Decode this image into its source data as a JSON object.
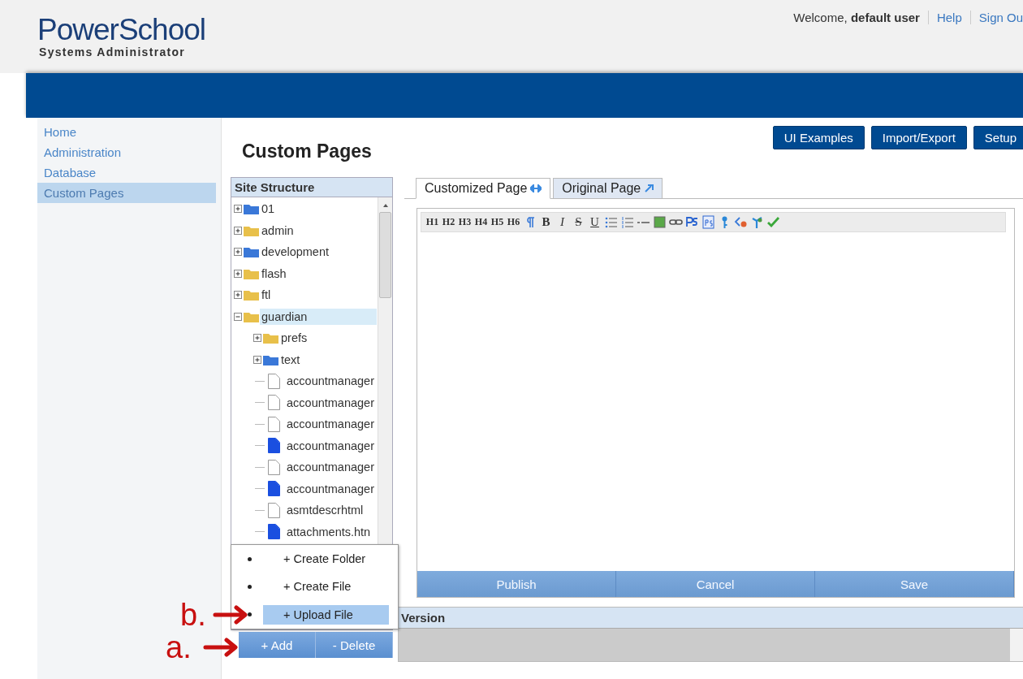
{
  "brand": {
    "name": "PowerSchool",
    "subtitle": "Systems Administrator"
  },
  "user_bar": {
    "welcome": "Welcome,",
    "user": "default user",
    "links": [
      "Help",
      "Sign Ou"
    ]
  },
  "sidebar": {
    "items": [
      {
        "label": "Home",
        "selected": false
      },
      {
        "label": "Administration",
        "selected": false
      },
      {
        "label": "Database",
        "selected": false
      },
      {
        "label": "Custom Pages",
        "selected": true
      }
    ]
  },
  "page_title": "Custom Pages",
  "header_buttons": [
    "UI Examples",
    "Import/Export",
    "Setup"
  ],
  "site_structure": {
    "title": "Site Structure",
    "tree": [
      {
        "name": "01",
        "kind": "folder",
        "color": "#3a78d8",
        "expanded": false,
        "selected": false
      },
      {
        "name": "admin",
        "kind": "folder",
        "color": "#e8c04a",
        "expanded": false,
        "selected": false
      },
      {
        "name": "development",
        "kind": "folder",
        "color": "#3a78d8",
        "expanded": false,
        "selected": false
      },
      {
        "name": "flash",
        "kind": "folder",
        "color": "#e8c04a",
        "expanded": false,
        "selected": false
      },
      {
        "name": "ftl",
        "kind": "folder",
        "color": "#e8c04a",
        "expanded": false,
        "selected": false
      },
      {
        "name": "guardian",
        "kind": "folder",
        "color": "#e8c04a",
        "expanded": true,
        "selected": true,
        "children": [
          {
            "name": "prefs",
            "kind": "folder",
            "color": "#e8c04a",
            "expanded": false,
            "selected": false
          },
          {
            "name": "text",
            "kind": "folder",
            "color": "#3a78d8",
            "expanded": false,
            "selected": false
          },
          {
            "name": "accountmanager",
            "kind": "file",
            "color": "#ffffff",
            "selected": false
          },
          {
            "name": "accountmanager",
            "kind": "file",
            "color": "#ffffff",
            "selected": false
          },
          {
            "name": "accountmanager",
            "kind": "file",
            "color": "#ffffff",
            "selected": false
          },
          {
            "name": "accountmanager",
            "kind": "file",
            "color": "#1a4fe0",
            "selected": false
          },
          {
            "name": "accountmanager",
            "kind": "file",
            "color": "#ffffff",
            "selected": false
          },
          {
            "name": "accountmanager",
            "kind": "file",
            "color": "#1a4fe0",
            "selected": false
          },
          {
            "name": "asmtdescrhtml",
            "kind": "file",
            "color": "#ffffff",
            "selected": false
          },
          {
            "name": "attachments.htn",
            "kind": "file",
            "color": "#1a4fe0",
            "selected": false
          }
        ]
      }
    ]
  },
  "add_menu": {
    "items": [
      {
        "label": "+ Create Folder",
        "selected": false
      },
      {
        "label": "+ Create File",
        "selected": false
      },
      {
        "label": "+ Upload File",
        "selected": true
      }
    ]
  },
  "tree_buttons": [
    "+ Add",
    "- Delete"
  ],
  "tabs": [
    {
      "label": "Customized Page",
      "selected": true
    },
    {
      "label": "Original Page",
      "selected": false
    }
  ],
  "toolbar": [
    {
      "kind": "heading",
      "label": "H1"
    },
    {
      "kind": "heading",
      "label": "H2"
    },
    {
      "kind": "heading",
      "label": "H3"
    },
    {
      "kind": "heading",
      "label": "H4"
    },
    {
      "kind": "heading",
      "label": "H5"
    },
    {
      "kind": "heading",
      "label": "H6"
    },
    {
      "kind": "paragraph"
    },
    {
      "kind": "bold",
      "label": "B"
    },
    {
      "kind": "italic",
      "label": "I"
    },
    {
      "kind": "strike",
      "label": "S"
    },
    {
      "kind": "underline",
      "label": "U"
    },
    {
      "kind": "bullets"
    },
    {
      "kind": "numbers"
    },
    {
      "kind": "rule"
    },
    {
      "kind": "image"
    },
    {
      "kind": "link"
    },
    {
      "kind": "ps"
    },
    {
      "kind": "ps-box"
    },
    {
      "kind": "key"
    },
    {
      "kind": "tag"
    },
    {
      "kind": "figure"
    },
    {
      "kind": "check"
    }
  ],
  "editor_buttons": [
    "Publish",
    "Cancel",
    "Save"
  ],
  "version": {
    "title": "Version"
  },
  "annotations": [
    {
      "label": "b.",
      "kind": "menu"
    },
    {
      "label": "a.",
      "kind": "add"
    }
  ]
}
